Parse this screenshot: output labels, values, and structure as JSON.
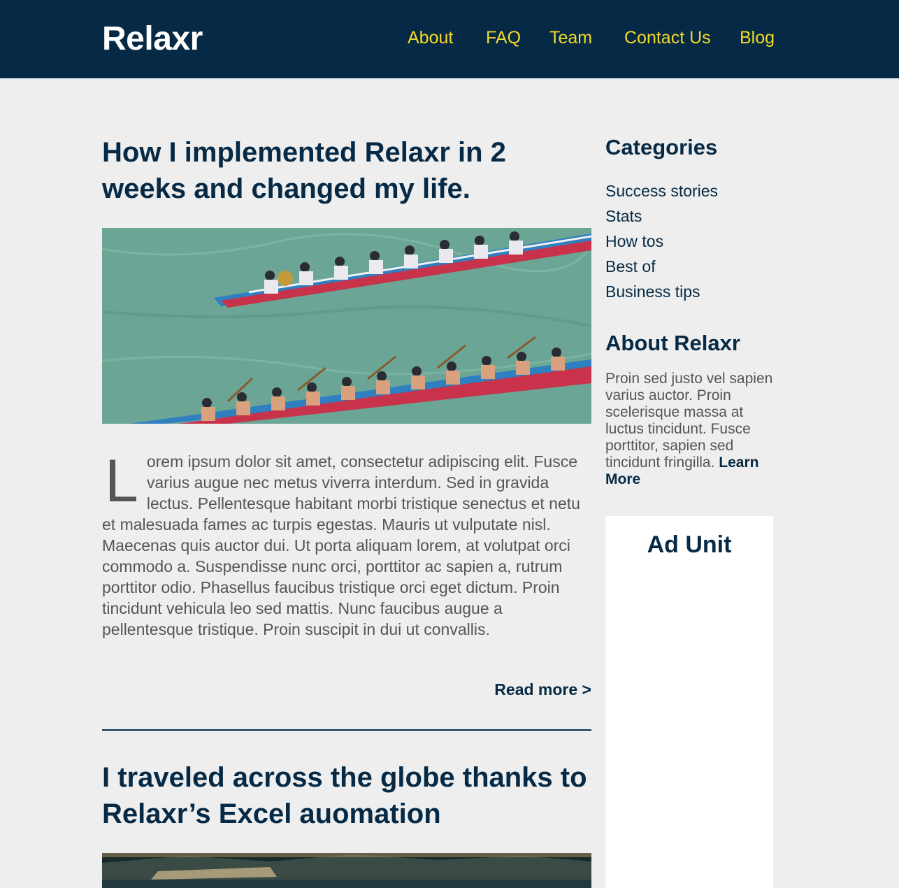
{
  "header": {
    "logo": "Relaxr",
    "nav": [
      "About",
      "FAQ",
      "Team",
      "Contact Us",
      "Blog"
    ]
  },
  "posts": [
    {
      "title": "How I implemented Relaxr in 2 weeks and changed my life.",
      "image_icon": "dragon-boat-race-image",
      "dropcap": "L",
      "body": "orem ipsum dolor sit amet, consectetur adipiscing elit. Fusce varius augue nec metus viverra interdum. Sed in gravida lectus. Pellentesque habitant morbi tristique senectus et netu et malesuada fames ac turpis egestas. Mauris ut vulputate nisl. Maecenas quis auctor dui. Ut porta aliquam lorem, at volutpat orci commodo a. Suspendisse nunc orci, porttitor ac sapien a, rutrum porttitor odio. Phasellus faucibus tristique orci eget dictum. Proin tincidunt vehicula leo sed mattis. Nunc faucibus augue a pellentesque tristique. Proin suscipit in dui ut convallis.",
      "read_more": "Read more >"
    },
    {
      "title": "I traveled across the globe thanks to Relaxr’s Excel auomation",
      "image_icon": "lake-landscape-image"
    }
  ],
  "sidebar": {
    "categories_heading": "Categories",
    "categories": [
      "Success stories",
      "Stats",
      "How tos",
      "Best of",
      "Business tips"
    ],
    "about_heading": "About Relaxr",
    "about_text": "Proin sed justo vel sapien varius auctor. Proin scelerisque massa at luctus tincidunt. Fusce porttitor, sapien sed tincidunt fringilla.",
    "learn_more": "Learn More",
    "ad_title": "Ad Unit"
  },
  "colors": {
    "header_bg": "#062a45",
    "nav_link": "#f4d92a",
    "page_bg": "#eeeeee",
    "text": "#555555"
  }
}
